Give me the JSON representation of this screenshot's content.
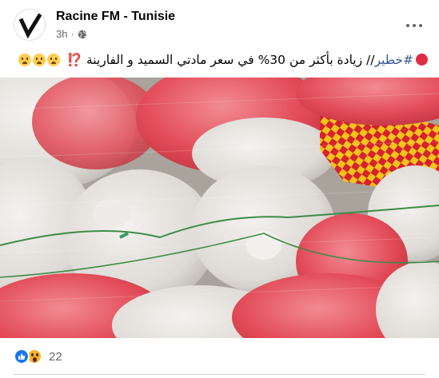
{
  "header": {
    "page_name": "Racine FM - Tunisie",
    "time": "3h",
    "separator": "·",
    "avatar_icon": "racine-fm-logo-icon",
    "privacy_icon": "globe-icon",
    "more_icon": "more-options-icon"
  },
  "post": {
    "hashtag": "#خطير",
    "text": "// زيادة بأكثر من 30% في سعر مادتي السميد و الفارينة",
    "bang": "⁉️",
    "leading_emoji": "red-circle-icon",
    "trailing_emojis": [
      "crying-face-icon",
      "scream-face-icon",
      "thinking-face-icon"
    ]
  },
  "photo": {
    "description_icon": "post-photo"
  },
  "footer": {
    "reaction_icons": [
      "like-reaction-icon",
      "wow-reaction-icon"
    ],
    "reaction_count": "22"
  },
  "colors": {
    "brand_blue": "#1877f2",
    "hashtag": "#385898",
    "secondary_text": "#65676b"
  }
}
